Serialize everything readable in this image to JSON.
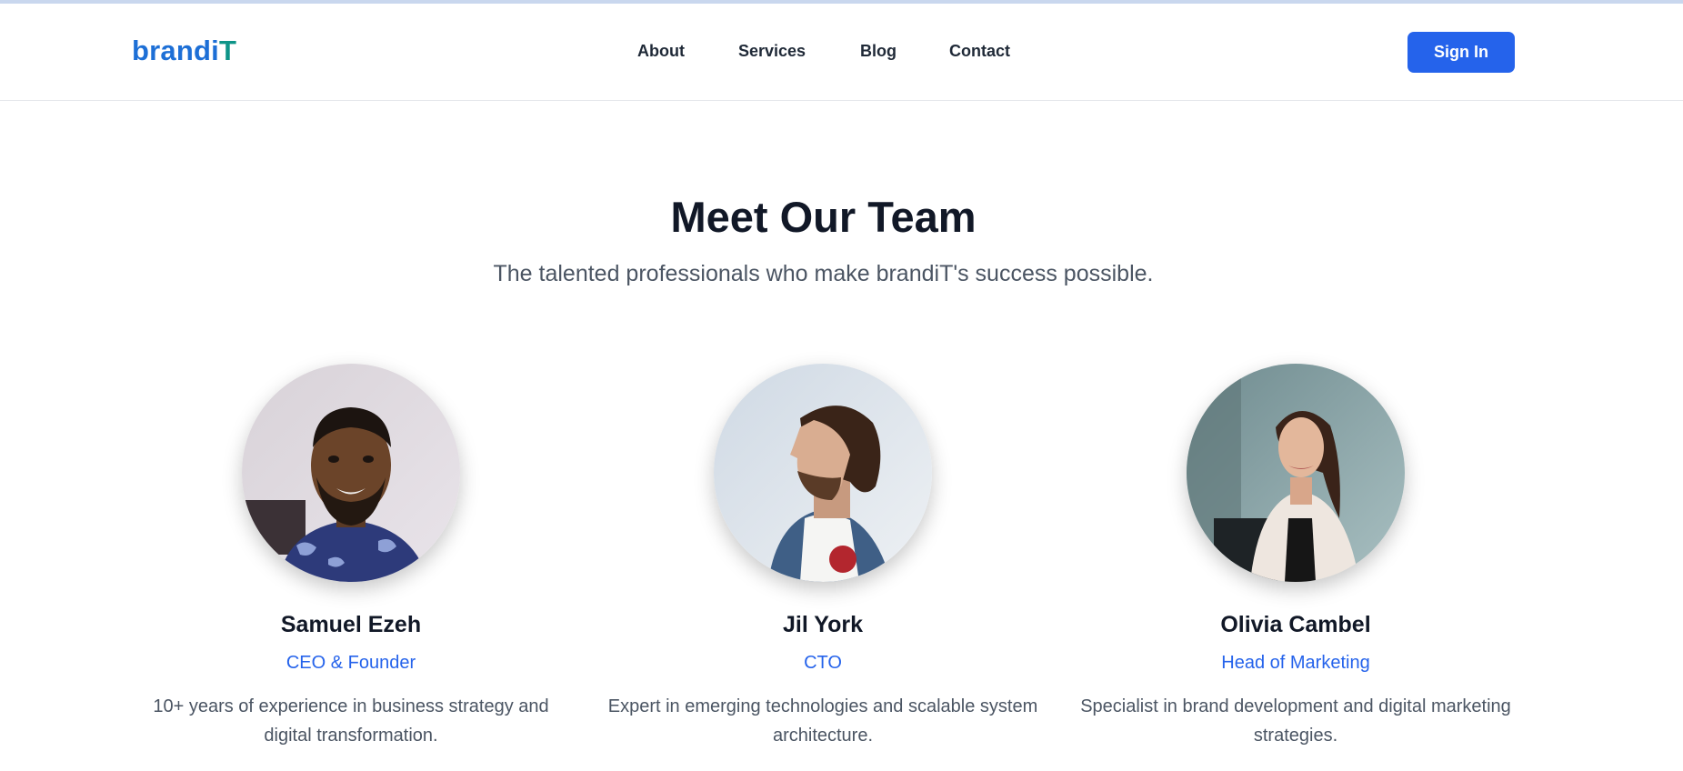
{
  "header": {
    "logo_part1": "brandi",
    "logo_part2": "T",
    "nav": [
      "About",
      "Services",
      "Blog",
      "Contact"
    ],
    "signin_label": "Sign In"
  },
  "hero": {
    "title": "Meet Our Team",
    "subtitle": "The talented professionals who make brandiT's success possible."
  },
  "team": [
    {
      "name": "Samuel Ezeh",
      "role": "CEO & Founder",
      "bio": "10+ years of experience in business strategy and digital transformation."
    },
    {
      "name": "Jil York",
      "role": "CTO",
      "bio": "Expert in emerging technologies and scalable system architecture."
    },
    {
      "name": "Olivia Cambel",
      "role": "Head of Marketing",
      "bio": "Specialist in brand development and digital marketing strategies."
    }
  ],
  "colors": {
    "accent": "#2563eb",
    "logo_blue": "#1d6fd6",
    "logo_teal": "#0d9488",
    "text_dark": "#111827",
    "text_muted": "#4b5563"
  }
}
